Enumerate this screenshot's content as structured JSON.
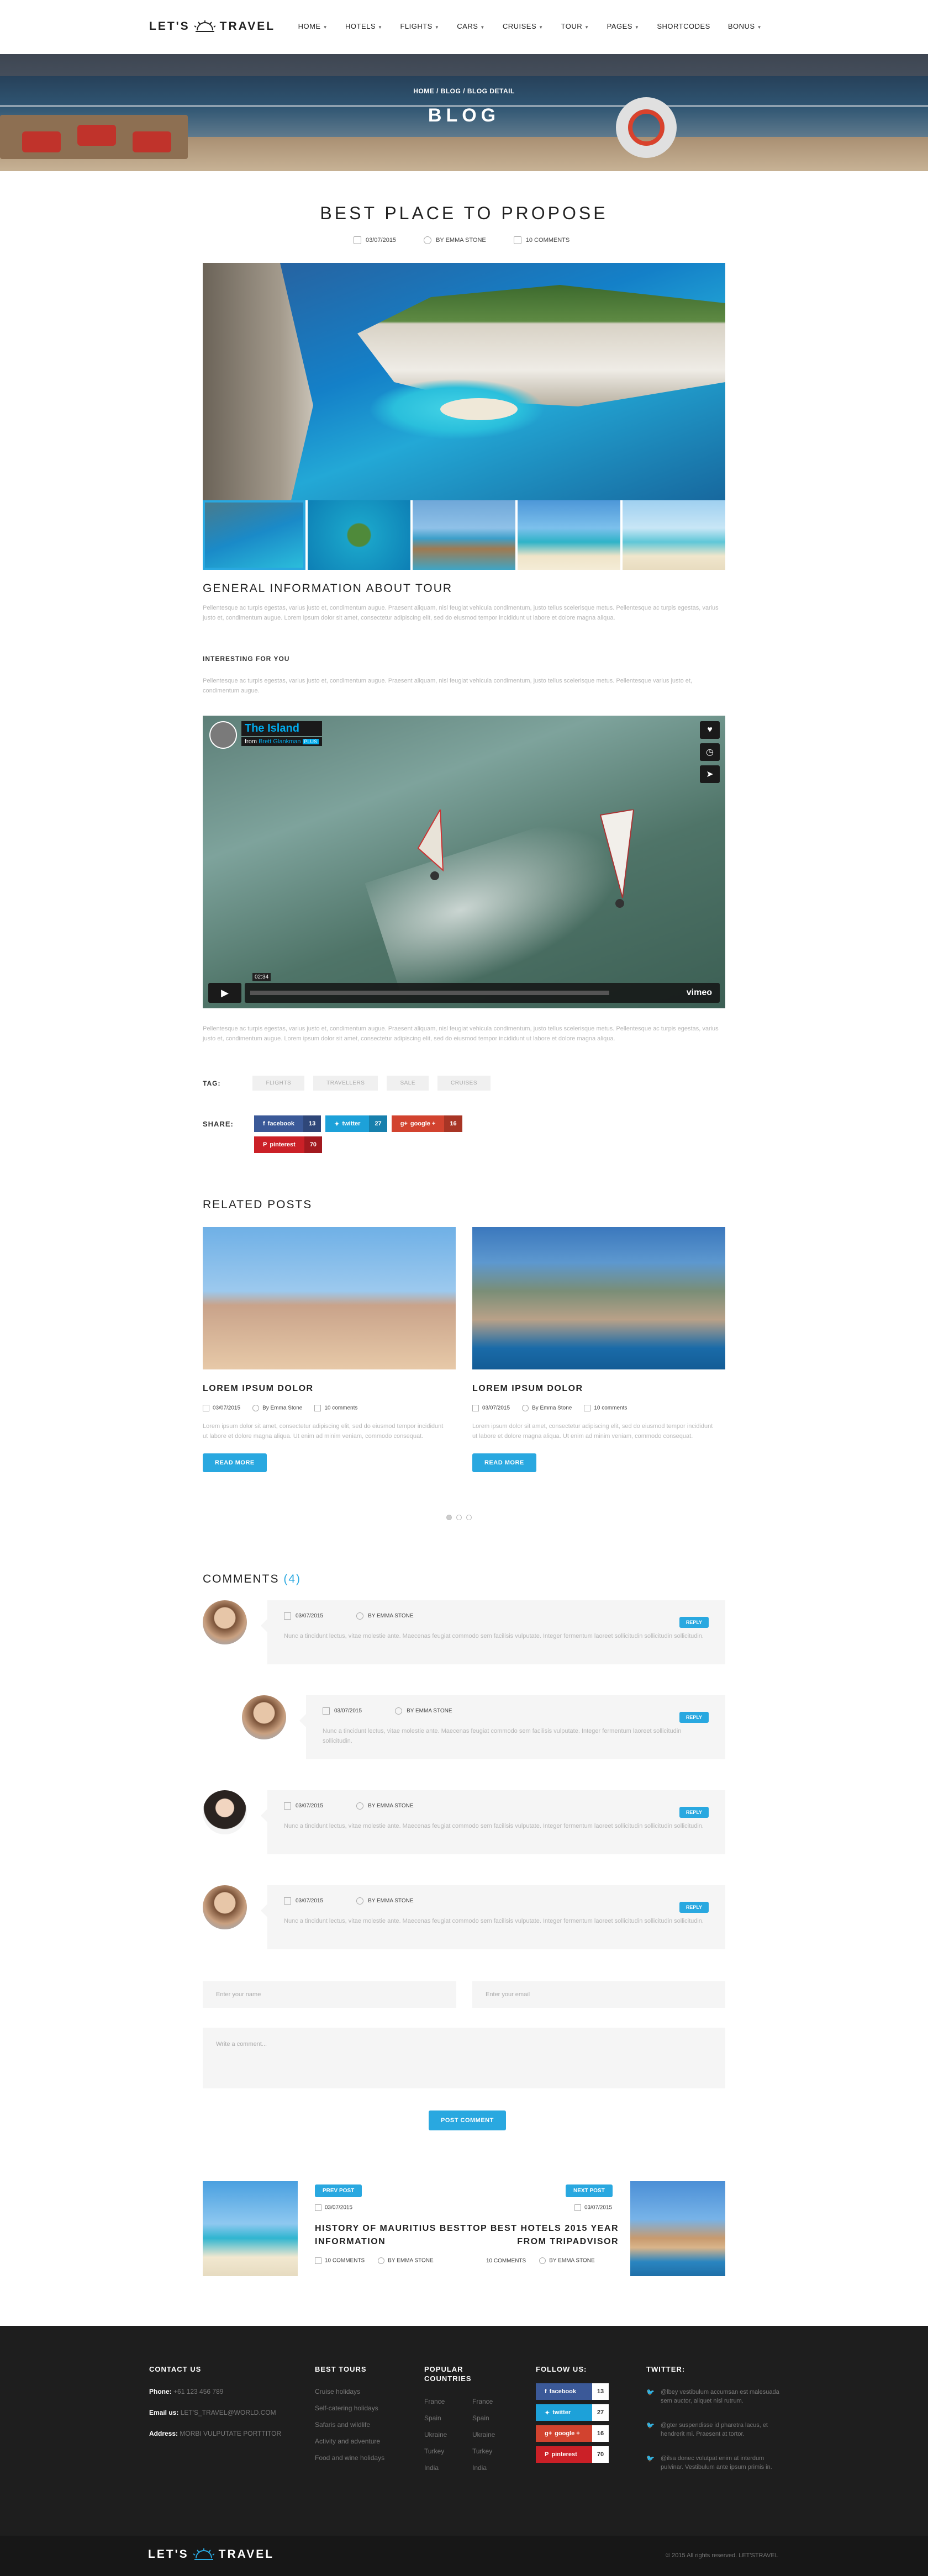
{
  "brand": {
    "logo_left": "LET'S",
    "logo_right": "TRAVEL"
  },
  "nav": [
    {
      "label": "HOME"
    },
    {
      "label": "HOTELS"
    },
    {
      "label": "FLIGHTS"
    },
    {
      "label": "CARS"
    },
    {
      "label": "CRUISES"
    },
    {
      "label": "TOUR"
    },
    {
      "label": "PAGES"
    },
    {
      "label": "SHORTCODES"
    },
    {
      "label": "BONUS"
    }
  ],
  "hero": {
    "breadcrumb": "HOME / BLOG / BLOG DETAIL",
    "title": "BLOG"
  },
  "post": {
    "title": "BEST PLACE TO PROPOSE",
    "date": "03/07/2015",
    "author": "BY EMMA STONE",
    "comments": "10 COMMENTS",
    "section_title": "GENERAL INFORMATION ABOUT TOUR",
    "para1": "Pellentesque ac turpis egestas, varius justo et, condimentum augue. Praesent aliquam, nisl feugiat vehicula condimentum, justo tellus scelerisque metus. Pellentesque ac turpis egestas, varius justo et, condimentum augue. Lorem ipsum dolor sit amet, consectetur adipiscing elit, sed do eiusmod tempor incididunt ut labore et dolore magna aliqua.",
    "subheading": "INTERESTING FOR YOU",
    "para2": "Pellentesque ac turpis egestas, varius justo et, condimentum augue. Praesent aliquam, nisl feugiat vehicula condimentum, justo tellus scelerisque metus. Pellentesque varius justo et, condimentum augue.",
    "para3": "Pellentesque ac turpis egestas, varius justo et, condimentum augue. Praesent aliquam, nisl feugiat vehicula condimentum, justo tellus scelerisque metus. Pellentesque ac turpis egestas, varius justo et, condimentum augue. Lorem ipsum dolor sit amet, consectetur adipiscing elit, sed do eiusmod tempor incididunt ut labore et dolore magna aliqua."
  },
  "video": {
    "title": "The Island",
    "from": "from",
    "author": "Brett Glankman",
    "badge": "PLUS",
    "time": "02:34",
    "brand": "vimeo"
  },
  "tags": {
    "label": "TAG:",
    "items": [
      "FLIGHTS",
      "TRAVELLERS",
      "SALE",
      "CRUISES"
    ]
  },
  "share": {
    "label": "SHARE:",
    "buttons": [
      {
        "name": "facebook",
        "count": "13",
        "color": "#3b5998"
      },
      {
        "name": "twitter",
        "count": "27",
        "color": "#1da1d9"
      },
      {
        "name": "google +",
        "count": "16",
        "color": "#d2432f"
      },
      {
        "name": "pinterest",
        "count": "70",
        "color": "#cb2027"
      }
    ]
  },
  "related": {
    "title": "RELATED POSTS",
    "posts": [
      {
        "title": "LOREM IPSUM DOLOR",
        "date": "03/07/2015",
        "author": "By Emma Stone",
        "comments": "10 comments",
        "text": "Lorem ipsum dolor sit amet, consectetur adipiscing elit, sed do eiusmod tempor incididunt ut labore et dolore magna aliqua. Ut enim ad minim veniam, commodo consequat.",
        "button": "READ MORE"
      },
      {
        "title": "LOREM IPSUM DOLOR",
        "date": "03/07/2015",
        "author": "By Emma Stone",
        "comments": "10 comments",
        "text": "Lorem ipsum dolor sit amet, consectetur adipiscing elit, sed do eiusmod tempor incididunt ut labore et dolore magna aliqua. Ut enim ad minim veniam, commodo consequat.",
        "button": "READ MORE"
      }
    ]
  },
  "comments": {
    "title": "COMMENTS",
    "count": "(4)",
    "items": [
      {
        "date": "03/07/2015",
        "author": "BY EMMA STONE",
        "text": "Nunc a tincidunt lectus, vitae molestie ante. Maecenas feugiat commodo sem facilisis vulputate. Integer fermentum laoreet sollicitudin sollicitudin sollicitudin.",
        "reply": "REPLY"
      },
      {
        "date": "03/07/2015",
        "author": "BY EMMA STONE",
        "text": "Nunc a tincidunt lectus, vitae molestie ante. Maecenas feugiat commodo sem facilisis vulputate. Integer fermentum laoreet sollicitudin sollicitudin.",
        "reply": "REPLY"
      },
      {
        "date": "03/07/2015",
        "author": "BY EMMA STONE",
        "text": "Nunc a tincidunt lectus, vitae molestie ante. Maecenas feugiat commodo sem facilisis vulputate. Integer fermentum laoreet sollicitudin sollicitudin sollicitudin.",
        "reply": "REPLY"
      },
      {
        "date": "03/07/2015",
        "author": "BY EMMA STONE",
        "text": "Nunc a tincidunt lectus, vitae molestie ante. Maecenas feugiat commodo sem facilisis vulputate. Integer fermentum laoreet sollicitudin sollicitudin sollicitudin.",
        "reply": "REPLY"
      }
    ]
  },
  "form": {
    "name_placeholder": "Enter your name",
    "email_placeholder": "Enter your email",
    "comment_placeholder": "Write a comment...",
    "submit": "POST COMMENT"
  },
  "prevnext": [
    {
      "badge": "PREV POST",
      "date": "03/07/2015",
      "title": "HISTORY OF MAURITIUS BEST INFORMATION",
      "comments": "10 COMMENTS",
      "author": "BY EMMA STONE"
    },
    {
      "badge": "NEXT POST",
      "date": "03/07/2015",
      "title": "TOP BEST HOTELS 2015 YEAR FROM TRIPADVISOR",
      "comments": "10 COMMENTS",
      "author": "BY EMMA STONE"
    }
  ],
  "footer": {
    "contact": {
      "title": "CONTACT US",
      "phone_label": "Phone:",
      "phone": "+61 123 456 789",
      "email_label": "Email us:",
      "email": "LET'S_TRAVEL@WORLD.COM",
      "address_label": "Address:",
      "address": "MORBI VULPUTATE PORTTITOR"
    },
    "tours": {
      "title": "BEST TOURS",
      "items": [
        "Cruise holidays",
        "Self-catering holidays",
        "Safaris and wildlife",
        "Activity and adventure",
        "Food and wine holidays"
      ]
    },
    "countries": {
      "title": "POPULAR COUNTRIES",
      "col1": [
        "France",
        "Spain",
        "Ukraine",
        "Turkey",
        "India"
      ],
      "col2": [
        "France",
        "Spain",
        "Ukraine",
        "Turkey",
        "India"
      ]
    },
    "follow": {
      "title": "FOLLOW US:",
      "items": [
        {
          "name": "facebook",
          "count": "13",
          "color": "#3b5998"
        },
        {
          "name": "twitter",
          "count": "27",
          "color": "#1da1d9"
        },
        {
          "name": "google +",
          "count": "16",
          "color": "#d2432f"
        },
        {
          "name": "pinterest",
          "count": "70",
          "color": "#cb2027"
        }
      ]
    },
    "twitter": {
      "title": "TWITTER:",
      "items": [
        "@lbey vestibulum accumsan est malesuada sem auctor, aliquet nisl rutrum.",
        "@gter suspendisse id pharetra lacus, et hendrerit mi. Praesent at tortor.",
        "@ilsa donec volutpat enim at interdum pulvinar. Vestibulum ante ipsum primis in."
      ]
    },
    "copyright": "© 2015 All rights reserved. LET'STRAVEL"
  },
  "colors": {
    "accent": "#29a8e0",
    "footer_bg": "#1e1e1e"
  }
}
